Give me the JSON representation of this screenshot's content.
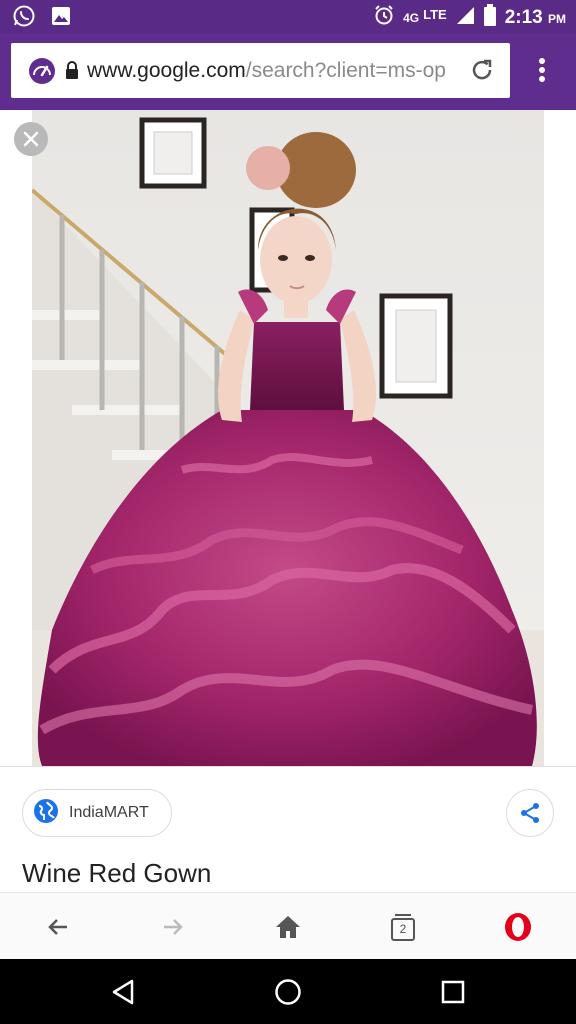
{
  "status_bar": {
    "time": "2:13",
    "ampm": "PM",
    "network_small": "4G",
    "network": "LTE"
  },
  "browser": {
    "url_host": "www.google.com",
    "url_path": "/search?client=ms-op"
  },
  "result": {
    "source": "IndiaMART",
    "title": "Wine Red Gown"
  },
  "browser_nav": {
    "tab_count": "2"
  },
  "colors": {
    "status_bar": "#5a2a87",
    "toolbar": "#5f2d8e",
    "opera_red": "#e3001b",
    "link_blue": "#1a73e8"
  },
  "icons": {
    "status_left": [
      "whatsapp-icon",
      "gallery-icon"
    ],
    "status_right": [
      "alarm-icon",
      "signal-icon",
      "battery-icon"
    ],
    "toolbar": [
      "speed-dial-icon",
      "lock-icon",
      "reload-icon",
      "overflow-menu-icon"
    ],
    "viewer": [
      "close-icon",
      "globe-icon",
      "share-icon"
    ],
    "browser_nav": [
      "back-arrow-icon",
      "forward-arrow-icon",
      "home-icon",
      "tabs-icon",
      "opera-logo-icon"
    ],
    "system_nav": [
      "android-back-icon",
      "android-home-icon",
      "android-recents-icon"
    ]
  }
}
